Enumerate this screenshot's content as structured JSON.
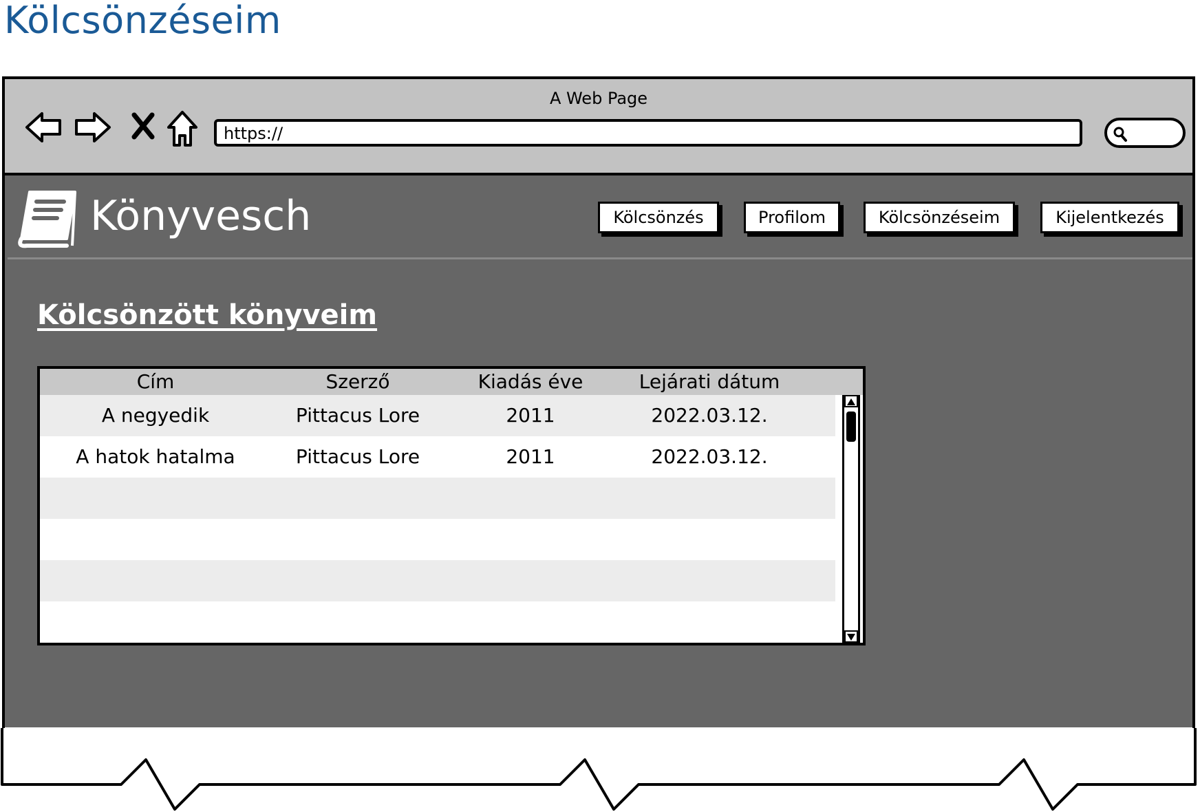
{
  "page_title": "Kölcsönzéseim",
  "browser": {
    "window_title": "A Web Page",
    "url": "https://",
    "icons": [
      "back-icon",
      "forward-icon",
      "close-icon",
      "home-icon",
      "search-icon"
    ]
  },
  "site": {
    "name": "Könyvesch",
    "logo_icon": "book-icon",
    "nav": [
      {
        "label": "Kölcsönzés"
      },
      {
        "label": "Profilom"
      },
      {
        "label": "Kölcsönzéseim"
      },
      {
        "label": "Kijelentkezés"
      }
    ]
  },
  "section": {
    "title": "Kölcsönzött könyveim"
  },
  "table": {
    "columns": [
      "Cím",
      "Szerző",
      "Kiadás éve",
      "Lejárati dátum"
    ],
    "rows": [
      [
        "A negyedik",
        "Pittacus Lore",
        "2011",
        "2022.03.12."
      ],
      [
        "A hatok hatalma",
        "Pittacus Lore",
        "2011",
        "2022.03.12."
      ]
    ]
  },
  "colors": {
    "title_blue": "#1a5a96",
    "site_bg": "#666666",
    "chrome_bg": "#c2c2c2"
  }
}
